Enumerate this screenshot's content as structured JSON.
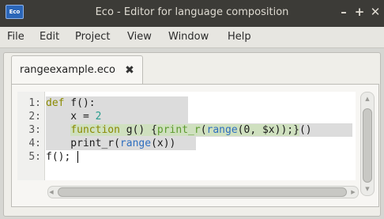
{
  "window": {
    "app_icon": "eco-app-icon",
    "app_icon_text": "Eco",
    "title": "Eco - Editor for language composition",
    "minimize": "–",
    "maximize": "+",
    "close": "✕"
  },
  "menu": {
    "items": [
      "File",
      "Edit",
      "Project",
      "View",
      "Window",
      "Help"
    ]
  },
  "tab": {
    "label": "rangeexample.eco",
    "close": "✖"
  },
  "editor": {
    "line_numbers": [
      "1:",
      "2:",
      "3:",
      "4:",
      "5:"
    ],
    "lines": [
      {
        "t1": "def",
        "t2": " f():"
      },
      {
        "t1": "    x = ",
        "t2": "2"
      },
      {
        "t0": "    ",
        "t1": "function",
        "t2": " g() {",
        "t3": "print_r",
        "t4": "(",
        "t5": "range",
        "t6": "(0, $x));}",
        "t7": "()"
      },
      {
        "t1": "    print_r(",
        "t2": "range",
        "t3": "(x))"
      },
      {
        "t1": "f();"
      }
    ]
  },
  "colors": {
    "titlebar": "#3c3b37",
    "python_highlight": "#dcdcdc",
    "php_highlight": "#cfe0bf",
    "keyword": "#8a8a00",
    "number": "#2a9d8f",
    "builtin": "#2f6fbf"
  }
}
